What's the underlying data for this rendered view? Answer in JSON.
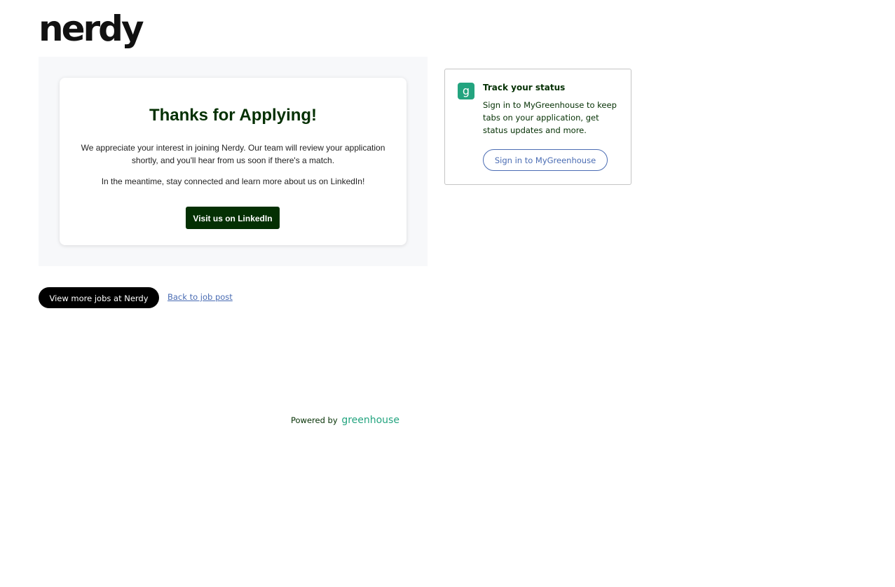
{
  "header": {
    "logo_text": "nerdy"
  },
  "thanks": {
    "title": "Thanks for Applying!",
    "paragraph1": "We appreciate your interest in joining Nerdy. Our team will review your application shortly, and you'll hear from us soon if there's a match.",
    "paragraph2": "In the meantime, stay connected and learn more about us on LinkedIn!",
    "linkedin_button": "Visit us on LinkedIn"
  },
  "status": {
    "badge": "g",
    "title": "Track your status",
    "text": "Sign in to MyGreenhouse to keep tabs on your application, get status updates and more.",
    "signin_button": "Sign in to MyGreenhouse"
  },
  "actions": {
    "more_jobs_button": "View more jobs at Nerdy",
    "back_link": "Back to job post"
  },
  "footer": {
    "powered_by": "Powered by",
    "brand": "greenhouse"
  },
  "colors": {
    "brand_dark_green": "#043003",
    "greenhouse_green": "#23a47f",
    "link_blue": "#4a6cb3",
    "panel_bg": "#f7f8fa"
  }
}
